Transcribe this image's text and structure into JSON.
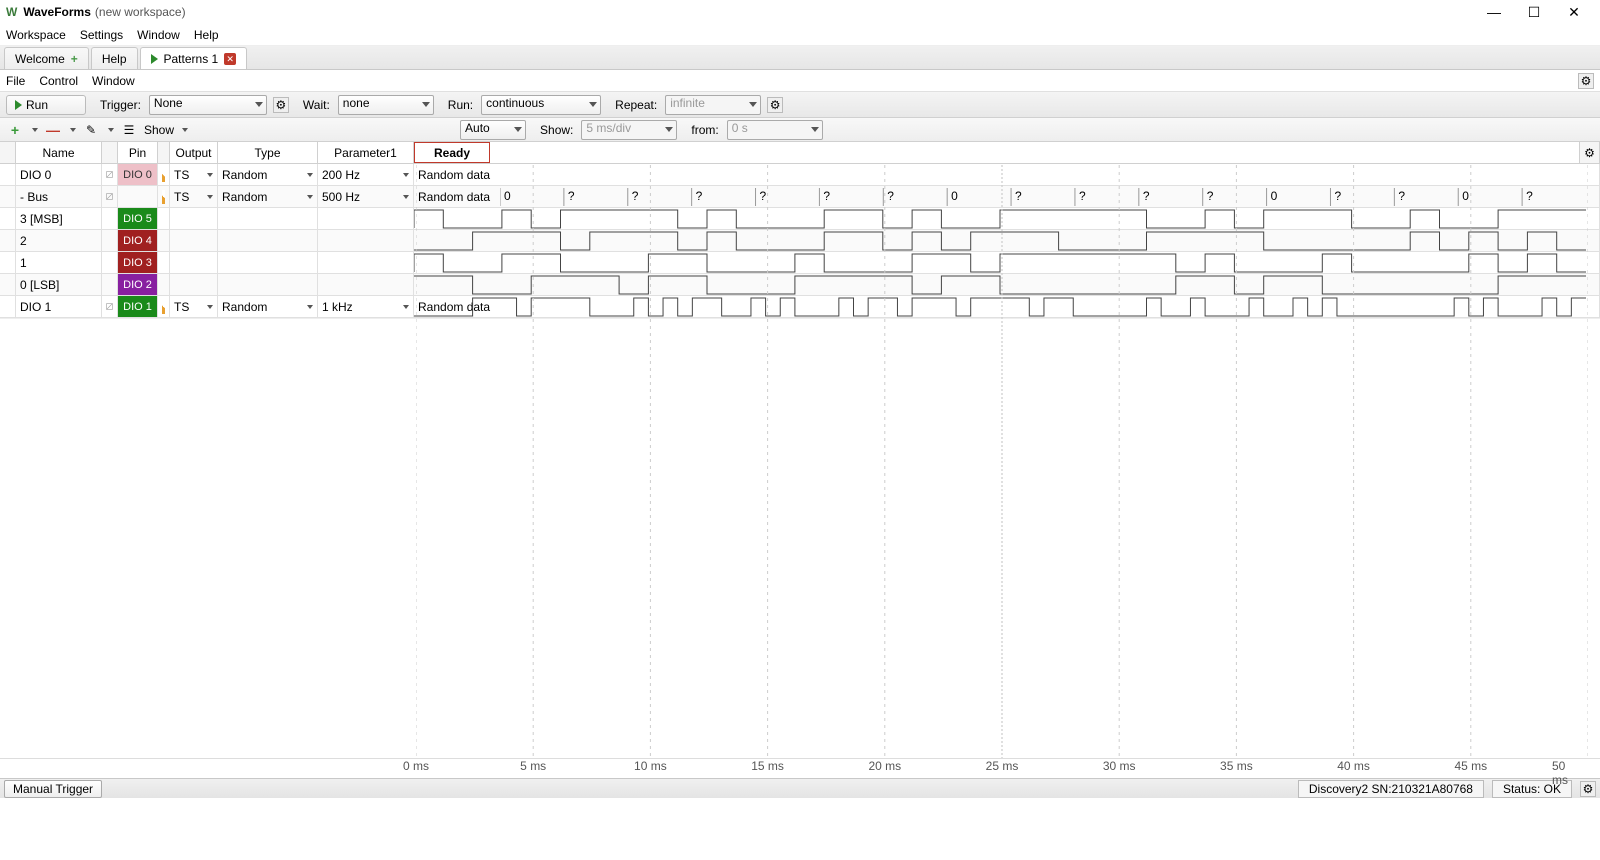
{
  "window": {
    "app": "WaveForms",
    "workspace": "(new workspace)"
  },
  "menu": [
    "Workspace",
    "Settings",
    "Window",
    "Help"
  ],
  "tabs": [
    {
      "label": "Welcome",
      "kind": "plus"
    },
    {
      "label": "Help",
      "kind": "plain"
    },
    {
      "label": "Patterns 1",
      "kind": "run",
      "active": true
    }
  ],
  "submenu": [
    "File",
    "Control",
    "Window"
  ],
  "toolbar": {
    "run": "Run",
    "trigger_label": "Trigger:",
    "trigger_value": "None",
    "wait_label": "Wait:",
    "wait_value": "none",
    "runmode_label": "Run:",
    "runmode_value": "continuous",
    "repeat_label": "Repeat:",
    "repeat_value": "infinite"
  },
  "toolbar2": {
    "show": "Show",
    "auto": "Auto",
    "show_label": "Show:",
    "show_value": "5 ms/div",
    "from_label": "from:",
    "from_value": "0 s"
  },
  "columns": {
    "name": "Name",
    "pin": "Pin",
    "output": "Output",
    "type": "Type",
    "param": "Parameter1",
    "ready": "Ready"
  },
  "rows": [
    {
      "name": "DIO 0",
      "pin": "DIO  0",
      "pinClass": "pinpink",
      "output": "TS",
      "type": "Random",
      "param": "200 Hz",
      "wave": "Random data",
      "hasControls": true
    },
    {
      "name": "- Bus",
      "pin": "",
      "pinClass": "",
      "output": "TS",
      "type": "Random",
      "param": "500 Hz",
      "wave": "Random data",
      "hasControls": true
    },
    {
      "name": "3 [MSB]",
      "pin": "DIO  5",
      "pinClass": "pingreen",
      "output": "",
      "type": "",
      "param": "",
      "wave": "",
      "hasControls": false
    },
    {
      "name": "2",
      "pin": "DIO  4",
      "pinClass": "pinred",
      "output": "",
      "type": "",
      "param": "",
      "wave": "",
      "hasControls": false
    },
    {
      "name": "1",
      "pin": "DIO  3",
      "pinClass": "pinred",
      "output": "",
      "type": "",
      "param": "",
      "wave": "",
      "hasControls": false
    },
    {
      "name": "0 [LSB]",
      "pin": "DIO  2",
      "pinClass": "pinpurple",
      "output": "",
      "type": "",
      "param": "",
      "wave": "",
      "hasControls": false
    },
    {
      "name": "DIO 1",
      "pin": "DIO  1",
      "pinClass": "pingreen2",
      "output": "TS",
      "type": "Random",
      "param": "1 kHz",
      "wave": "Random data",
      "hasControls": true
    }
  ],
  "busValues": [
    "0",
    "?",
    "?",
    "?",
    "?",
    "?",
    "?",
    "0",
    "?",
    "?",
    "?",
    "?",
    "0",
    "?",
    "?",
    "0",
    "?"
  ],
  "timeaxis": [
    "0 ms",
    "5 ms",
    "10 ms",
    "15 ms",
    "20 ms",
    "25 ms",
    "30 ms",
    "35 ms",
    "40 ms",
    "45 ms",
    "50 ms"
  ],
  "status": {
    "manual": "Manual Trigger",
    "device": "Discovery2 SN:210321A80768",
    "ok": "Status: OK"
  }
}
